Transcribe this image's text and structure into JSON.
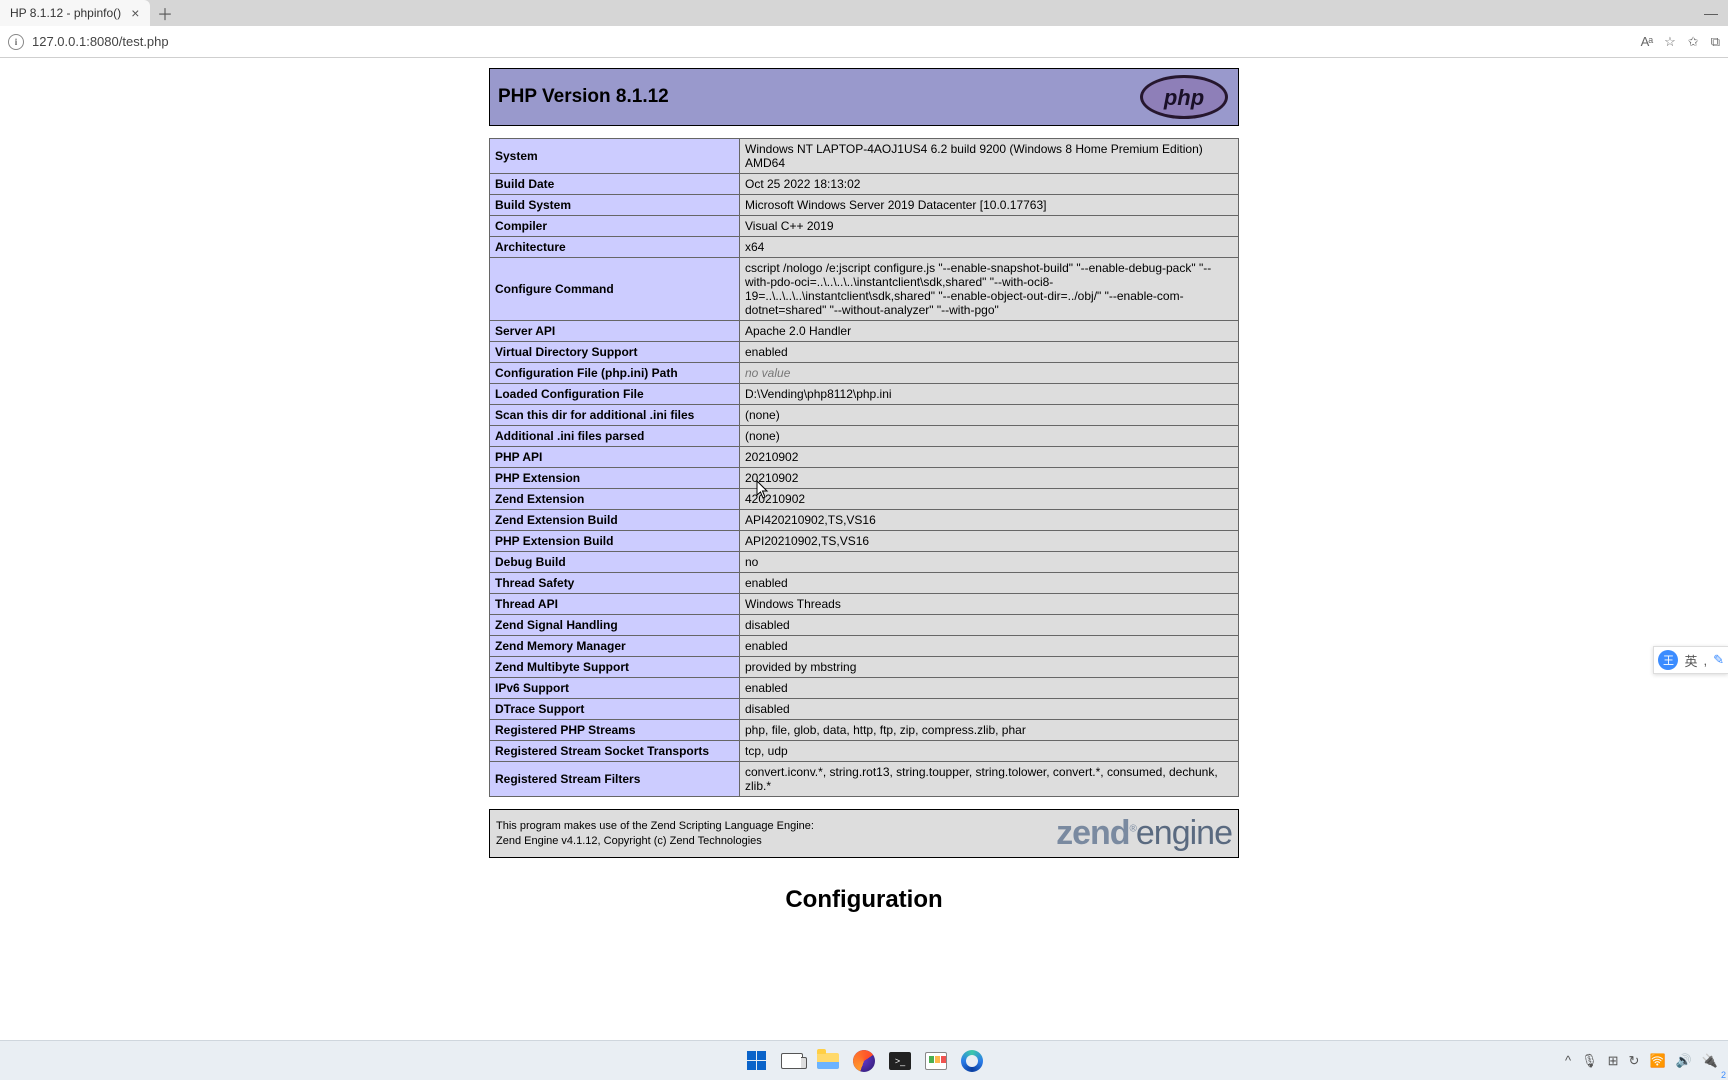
{
  "browser": {
    "tab_title": "HP 8.1.12 - phpinfo()",
    "url": "127.0.0.1:8080/test.php",
    "reading_view": "Aᵃ"
  },
  "phpinfo": {
    "header": "PHP Version 8.1.12",
    "rows": [
      {
        "k": "System",
        "v": "Windows NT LAPTOP-4AOJ1US4 6.2 build 9200 (Windows 8 Home Premium Edition) AMD64"
      },
      {
        "k": "Build Date",
        "v": "Oct 25 2022 18:13:02"
      },
      {
        "k": "Build System",
        "v": "Microsoft Windows Server 2019 Datacenter [10.0.17763]"
      },
      {
        "k": "Compiler",
        "v": "Visual C++ 2019"
      },
      {
        "k": "Architecture",
        "v": "x64"
      },
      {
        "k": "Configure Command",
        "v": "cscript /nologo /e:jscript configure.js \"--enable-snapshot-build\" \"--enable-debug-pack\" \"--with-pdo-oci=..\\..\\..\\..\\instantclient\\sdk,shared\" \"--with-oci8-19=..\\..\\..\\..\\instantclient\\sdk,shared\" \"--enable-object-out-dir=../obj/\" \"--enable-com-dotnet=shared\" \"--without-analyzer\" \"--with-pgo\""
      },
      {
        "k": "Server API",
        "v": "Apache 2.0 Handler"
      },
      {
        "k": "Virtual Directory Support",
        "v": "enabled"
      },
      {
        "k": "Configuration File (php.ini) Path",
        "v": "",
        "no_value": true
      },
      {
        "k": "Loaded Configuration File",
        "v": "D:\\Vending\\php8112\\php.ini"
      },
      {
        "k": "Scan this dir for additional .ini files",
        "v": "(none)"
      },
      {
        "k": "Additional .ini files parsed",
        "v": "(none)"
      },
      {
        "k": "PHP API",
        "v": "20210902"
      },
      {
        "k": "PHP Extension",
        "v": "20210902"
      },
      {
        "k": "Zend Extension",
        "v": "420210902"
      },
      {
        "k": "Zend Extension Build",
        "v": "API420210902,TS,VS16"
      },
      {
        "k": "PHP Extension Build",
        "v": "API20210902,TS,VS16"
      },
      {
        "k": "Debug Build",
        "v": "no"
      },
      {
        "k": "Thread Safety",
        "v": "enabled"
      },
      {
        "k": "Thread API",
        "v": "Windows Threads"
      },
      {
        "k": "Zend Signal Handling",
        "v": "disabled"
      },
      {
        "k": "Zend Memory Manager",
        "v": "enabled"
      },
      {
        "k": "Zend Multibyte Support",
        "v": "provided by mbstring"
      },
      {
        "k": "IPv6 Support",
        "v": "enabled"
      },
      {
        "k": "DTrace Support",
        "v": "disabled"
      },
      {
        "k": "Registered PHP Streams",
        "v": "php, file, glob, data, http, ftp, zip, compress.zlib, phar"
      },
      {
        "k": "Registered Stream Socket Transports",
        "v": "tcp, udp"
      },
      {
        "k": "Registered Stream Filters",
        "v": "convert.iconv.*, string.rot13, string.toupper, string.tolower, convert.*, consumed, dechunk, zlib.*"
      }
    ],
    "zend_line1": "This program makes use of the Zend Scripting Language Engine:",
    "zend_line2": "Zend Engine v4.1.12, Copyright (c) Zend Technologies",
    "config_heading": "Configuration",
    "no_value_text": "no value"
  },
  "ime": {
    "avatar": "王",
    "lang": "英",
    "comma": ",",
    "edit": "✎"
  },
  "tray": {
    "caret": "^",
    "mic": "🎙",
    "grid": "⊞",
    "sync": "↻",
    "wifi": "🛜",
    "vol": "🔊",
    "bat": "🔌",
    "badge": "2"
  }
}
